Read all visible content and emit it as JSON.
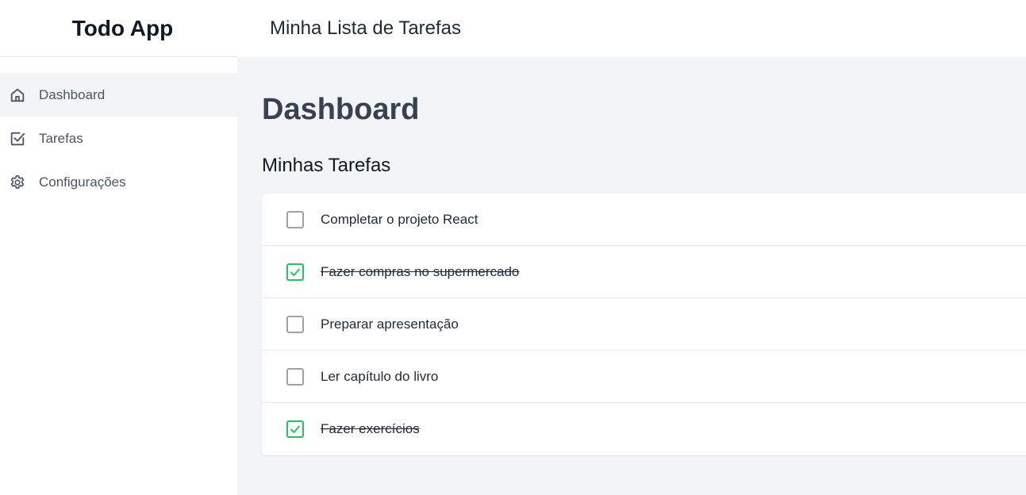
{
  "app": {
    "brand": "Todo App",
    "header_title": "Minha Lista de Tarefas"
  },
  "sidebar": {
    "items": [
      {
        "label": "Dashboard",
        "icon": "home-icon",
        "active": true
      },
      {
        "label": "Tarefas",
        "icon": "check-square-icon",
        "active": false
      },
      {
        "label": "Configurações",
        "icon": "gear-icon",
        "active": false
      }
    ]
  },
  "main": {
    "page_title": "Dashboard",
    "section_title": "Minhas Tarefas",
    "tasks": [
      {
        "text": "Completar o projeto React",
        "done": false
      },
      {
        "text": "Fazer compras no supermercado",
        "done": true
      },
      {
        "text": "Preparar apresentação",
        "done": false
      },
      {
        "text": "Ler capítulo do livro",
        "done": false
      },
      {
        "text": "Fazer exercícios",
        "done": true
      }
    ]
  },
  "colors": {
    "accent_check": "#22c55e",
    "main_bg": "#f3f4f6",
    "active_nav_bg": "#f3f4f6"
  }
}
